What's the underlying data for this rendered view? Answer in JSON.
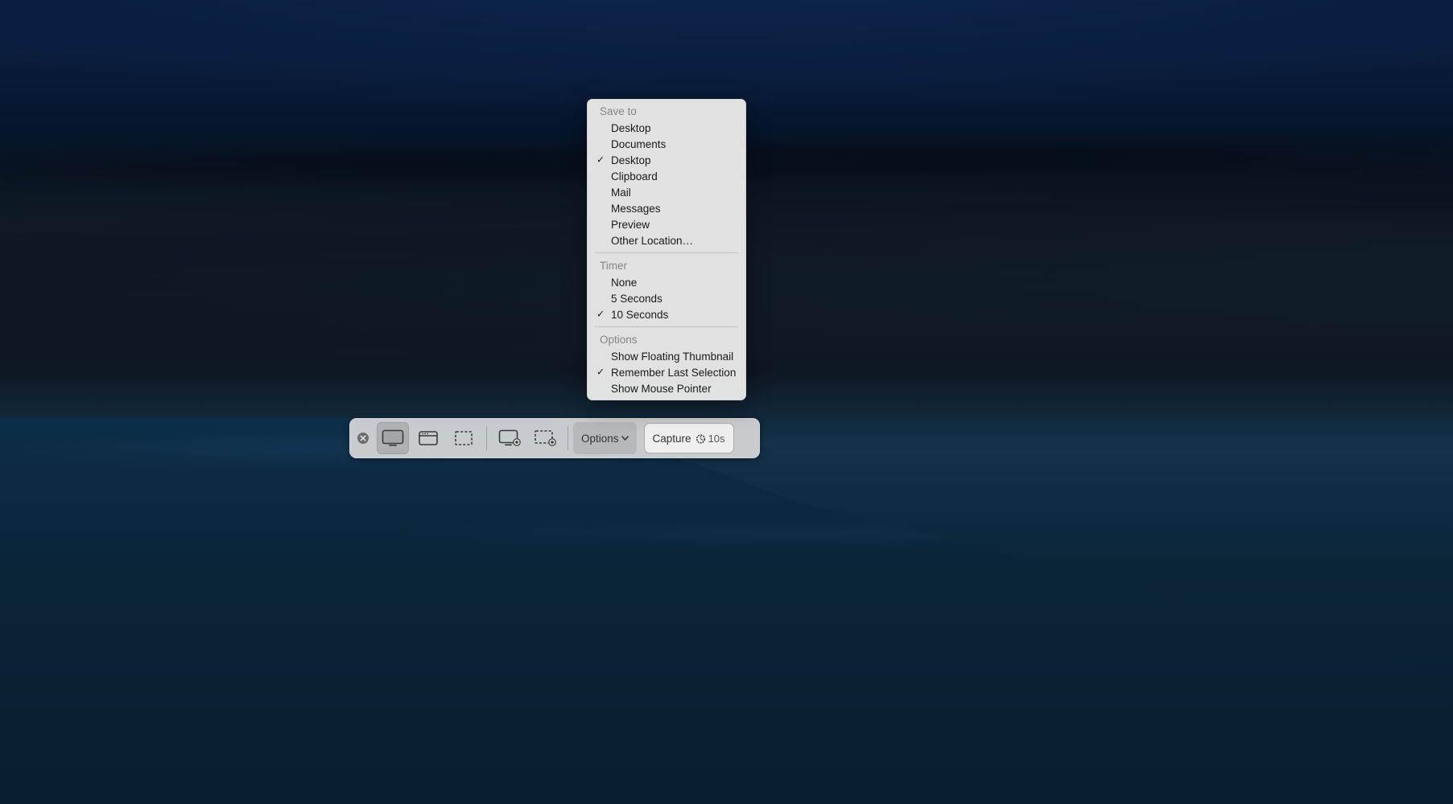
{
  "toolbar": {
    "options_label": "Options",
    "capture_label": "Capture",
    "capture_timer_label": "10s"
  },
  "menu": {
    "sections": [
      {
        "header": "Save to",
        "items": [
          {
            "label": "Desktop",
            "checked": false
          },
          {
            "label": "Documents",
            "checked": false
          },
          {
            "label": "Desktop",
            "checked": true
          },
          {
            "label": "Clipboard",
            "checked": false
          },
          {
            "label": "Mail",
            "checked": false
          },
          {
            "label": "Messages",
            "checked": false
          },
          {
            "label": "Preview",
            "checked": false
          },
          {
            "label": "Other Location…",
            "checked": false
          }
        ]
      },
      {
        "header": "Timer",
        "items": [
          {
            "label": "None",
            "checked": false
          },
          {
            "label": "5 Seconds",
            "checked": false
          },
          {
            "label": "10 Seconds",
            "checked": true
          }
        ]
      },
      {
        "header": "Options",
        "items": [
          {
            "label": "Show Floating Thumbnail",
            "checked": false
          },
          {
            "label": "Remember Last Selection",
            "checked": true
          },
          {
            "label": "Show Mouse Pointer",
            "checked": false
          }
        ]
      }
    ]
  }
}
